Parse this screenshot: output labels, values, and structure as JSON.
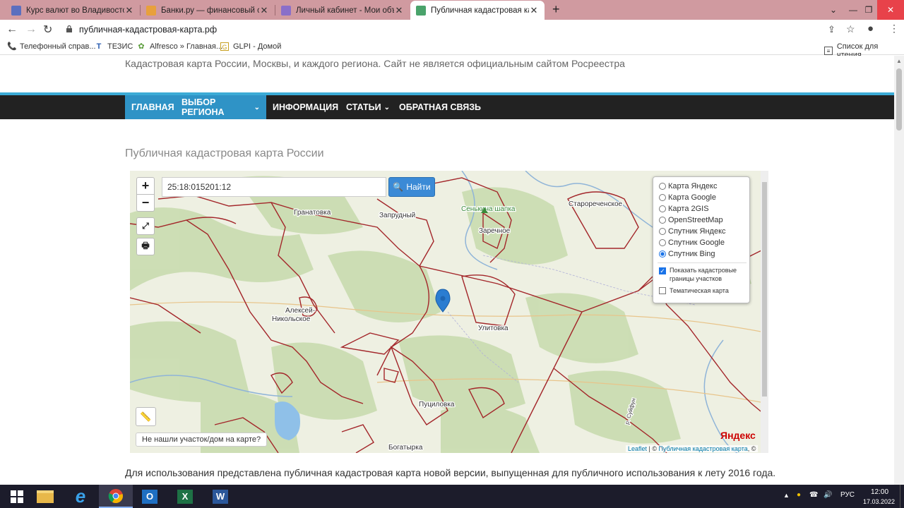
{
  "browser": {
    "tabs": [
      {
        "title": "Курс валют во Владивостоке на",
        "favicon_color": "#5b6fbf"
      },
      {
        "title": "Банки.ру — финансовый супер",
        "favicon_color": "#e8a03c"
      },
      {
        "title": "Личный кабинет - Мои объявле",
        "favicon_color": "#8a6fc9"
      },
      {
        "title": "Публичная кадастровая карта Р",
        "favicon_color": "#4aa36b"
      }
    ],
    "url": "публичная-кадастровая-карта.рф",
    "bookmarks": [
      {
        "label": "Телефонный справ..."
      },
      {
        "label": "ТЕЗИС"
      },
      {
        "label": "Alfresco » Главная..."
      },
      {
        "label": "GLPI - Домой"
      }
    ],
    "reading_list": "Список для чтения"
  },
  "site": {
    "subtitle": "Кадастровая карта России, Москвы, и каждого региона. Сайт не является официальным сайтом Росреестра",
    "nav": [
      {
        "label": "ГЛАВНАЯ"
      },
      {
        "label": "ВЫБОР РЕГИОНА"
      },
      {
        "label": "ИНФОРМАЦИЯ"
      },
      {
        "label": "СТАТЬИ"
      },
      {
        "label": "ОБРАТНАЯ СВЯЗЬ"
      }
    ],
    "heading": "Публичная кадастровая карта России",
    "description": "Для использования представлена публичная кадастровая карта новой версии, выпущенная для публичного использования к лету 2016 года."
  },
  "map": {
    "zoom_in": "+",
    "zoom_out": "−",
    "search_value": "25:18:015201:12",
    "find_label": "Найти",
    "layers": [
      {
        "label": "Карта Яндекс",
        "selected": false
      },
      {
        "label": "Карта Google",
        "selected": false
      },
      {
        "label": "Карта 2GIS",
        "selected": false
      },
      {
        "label": "OpenStreetMap",
        "selected": false
      },
      {
        "label": "Спутник Яндекс",
        "selected": false
      },
      {
        "label": "Спутник Google",
        "selected": false
      },
      {
        "label": "Спутник Bing",
        "selected": true
      }
    ],
    "overlays": [
      {
        "label_1": "Показать кадастровые",
        "label_2": "границы участков",
        "checked": true
      },
      {
        "label_1": "Тематическая карта",
        "checked": false
      }
    ],
    "place_names": [
      "Гранатовка",
      "Запрудный",
      "Сенькина шапка",
      "Заречное",
      "Старореченское",
      "Алексей-",
      "Никольское",
      "Улитовка",
      "Пуциловка",
      "Богатырка",
      "р. Суйфун"
    ],
    "not_found": "Не нашли участок/дом на карте?",
    "attribution_leaflet": "Leaflet",
    "attribution_sep": " | © ",
    "attribution_source": "Публичная кадастровая карта",
    "attribution_tail": ", ©",
    "provider": "Яндекс"
  },
  "taskbar": {
    "lang": "РУС",
    "time": "12:00",
    "date": "17.03.2022"
  },
  "colors": {
    "accent": "#2f93c6",
    "navbar": "#222222",
    "boundary": "#a3262a"
  }
}
